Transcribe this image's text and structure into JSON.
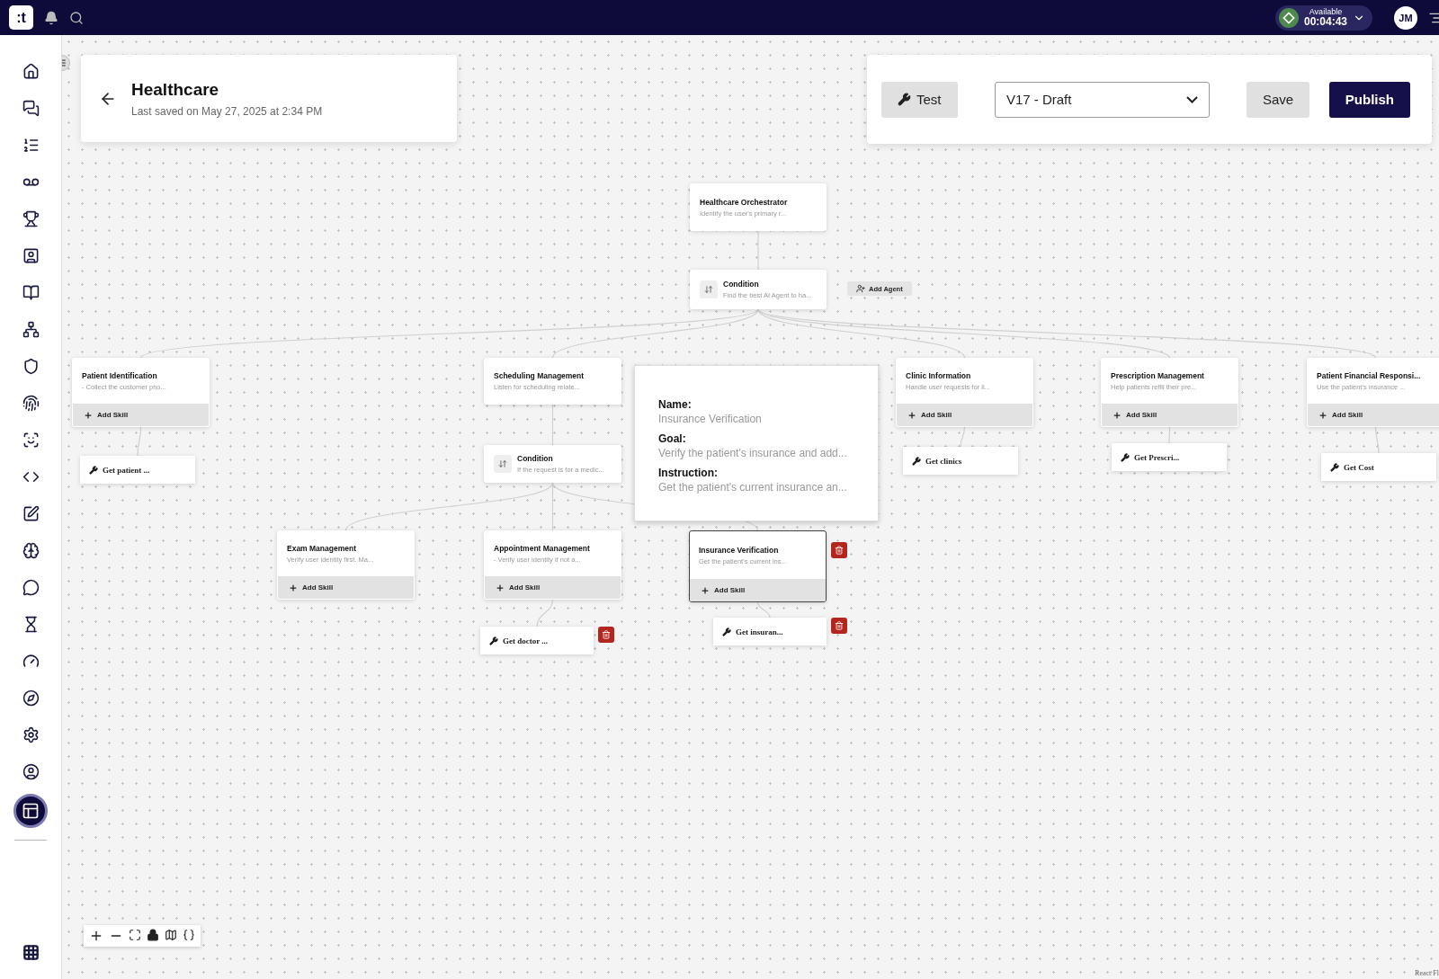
{
  "topbar": {
    "logo": ":t",
    "status": {
      "label": "Available",
      "timer": "00:04:43"
    },
    "avatar": "JM"
  },
  "sidebar": {
    "items": [
      {
        "selected": false
      },
      {
        "selected": false
      },
      {
        "selected": false
      },
      {
        "selected": false
      },
      {
        "selected": false
      },
      {
        "selected": false
      },
      {
        "selected": false
      },
      {
        "selected": false
      },
      {
        "selected": false
      },
      {
        "selected": false
      },
      {
        "selected": false
      },
      {
        "selected": false
      },
      {
        "selected": false
      },
      {
        "selected": false
      },
      {
        "selected": false
      },
      {
        "selected": false
      },
      {
        "selected": false
      },
      {
        "selected": false
      },
      {
        "selected": false
      },
      {
        "selected": false
      },
      {
        "selected": true
      }
    ]
  },
  "header": {
    "title": "Healthcare",
    "subtitle": "Last saved on May 27, 2025 at 2:34 PM"
  },
  "toolbar": {
    "test": "Test",
    "version": "V17 - Draft",
    "save": "Save",
    "publish": "Publish"
  },
  "add_agent": "Add Agent",
  "nodes": [
    {
      "kind": "agent",
      "title": "Healthcare Orchestrator",
      "description": "Identify the user's primary r...",
      "selected": false,
      "deletable": false
    },
    {
      "kind": "condition",
      "title": "Condition",
      "description": "Find the best AI Agent to ha...",
      "selected": false,
      "deletable": false
    },
    {
      "kind": "agent",
      "title": "Patient Identification",
      "description": "- Collect the customer pho...",
      "add_skill": "Add Skill",
      "selected": false,
      "deletable": false
    },
    {
      "kind": "agent",
      "title": "Scheduling Management",
      "description": "Listen for scheduling relate...",
      "selected": false,
      "deletable": false
    },
    {
      "kind": "agent",
      "title": "Clinic Information",
      "description": "Handle user requests for li...",
      "add_skill": "Add Skill",
      "selected": false,
      "deletable": false
    },
    {
      "kind": "agent",
      "title": "Prescription Management",
      "description": "Help patients refill their pre...",
      "add_skill": "Add Skill",
      "selected": false,
      "deletable": false
    },
    {
      "kind": "agent",
      "title": "Patient Financial Responsi...",
      "description": "Use the patient's insurance ...",
      "add_skill": "Add Skill",
      "selected": false,
      "deletable": false
    },
    {
      "kind": "skill",
      "title": "Get patient ...",
      "selected": false,
      "deletable": false
    },
    {
      "kind": "condition",
      "title": "Condition",
      "description": "If the request is for a medic...",
      "selected": false,
      "deletable": false
    },
    {
      "kind": "skill",
      "title": "Get clinics",
      "selected": false,
      "deletable": false
    },
    {
      "kind": "skill",
      "title": "Get Prescri...",
      "selected": false,
      "deletable": false
    },
    {
      "kind": "skill",
      "title": "Get Cost",
      "selected": false,
      "deletable": false
    },
    {
      "kind": "agent",
      "title": "Exam Management",
      "description": "Verify user identity first. Ma...",
      "add_skill": "Add Skill",
      "selected": false,
      "deletable": false
    },
    {
      "kind": "agent",
      "title": "Appointment Management",
      "description": "- Verify user identity if not a...",
      "add_skill": "Add Skill",
      "selected": false,
      "deletable": false
    },
    {
      "kind": "agent",
      "title": "Insurance Verification",
      "description": "Get the patient's current ins...",
      "add_skill": "Add Skill",
      "selected": true,
      "deletable": true
    },
    {
      "kind": "skill",
      "title": "Get doctor ...",
      "selected": false,
      "deletable": true
    },
    {
      "kind": "skill",
      "title": "Get insuran...",
      "selected": false,
      "deletable": true
    }
  ],
  "tooltip": {
    "fields": [
      {
        "label": "Name:",
        "value": "Insurance Verification"
      },
      {
        "label": "Goal:",
        "value": "Verify the patient's insurance and add..."
      },
      {
        "label": "Instruction:",
        "value": "Get the patient's current insurance an..."
      }
    ]
  },
  "attribution": "React Fl"
}
